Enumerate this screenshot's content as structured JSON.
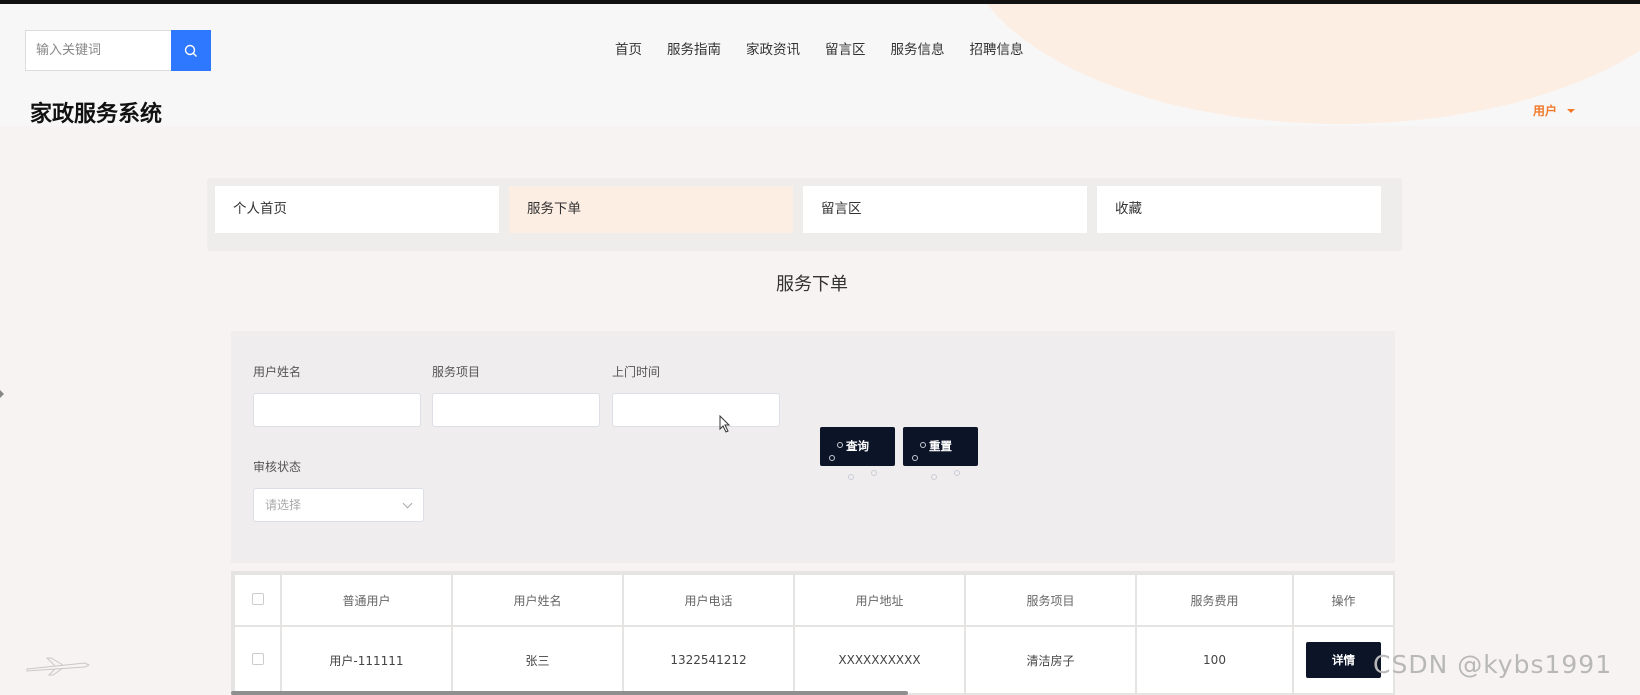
{
  "header": {
    "search_placeholder": "输入关键词",
    "site_title": "家政服务系统",
    "nav": [
      "首页",
      "服务指南",
      "家政资讯",
      "留言区",
      "服务信息",
      "招聘信息"
    ],
    "user_menu": "用户"
  },
  "tabs": [
    "个人首页",
    "服务下单",
    "留言区",
    "收藏"
  ],
  "active_tab": "服务下单",
  "page_heading": "服务下单",
  "filters": {
    "username_label": "用户姓名",
    "service_label": "服务项目",
    "visit_time_label": "上门时间",
    "status_label": "审核状态",
    "status_placeholder": "请选择",
    "query_button": "查询",
    "reset_button": "重置"
  },
  "table": {
    "headers": [
      "普通用户",
      "用户姓名",
      "用户电话",
      "用户地址",
      "服务项目",
      "服务费用",
      "操作"
    ],
    "rows": [
      [
        "用户-111111",
        "张三",
        "1322541212",
        "XXXXXXXXXX",
        "清洁房子",
        "100",
        "详情"
      ]
    ]
  },
  "watermark": "CSDN @kybs1991",
  "colors": {
    "accent_blue": "#2d78ff",
    "accent_orange": "#f07a2c",
    "dark_button": "#0c1428",
    "active_tab_bg": "#fdeee4"
  }
}
